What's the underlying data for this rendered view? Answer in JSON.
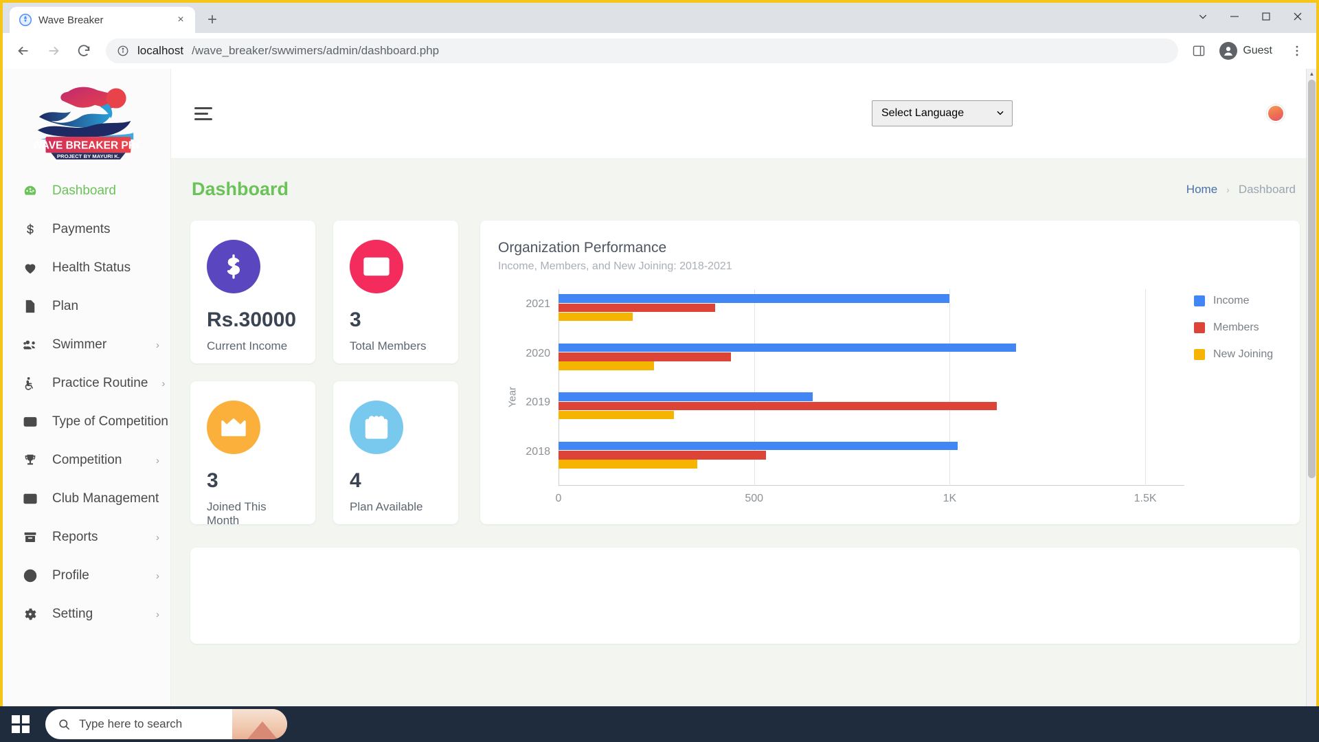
{
  "browser": {
    "tab_title": "Wave Breaker",
    "tab_favicon": "globe-icon",
    "new_tab_label": "+",
    "close_tab_label": "×",
    "url_host": "localhost",
    "url_path": "/wave_breaker/swwimers/admin/dashboard.php",
    "profile_label": "Guest"
  },
  "sidebar": {
    "brand": {
      "name": "WAVE BREAKER PRO",
      "tagline": "PROJECT BY MAYURI K."
    },
    "items": [
      {
        "label": "Dashboard",
        "icon": "dashboard-gauge-icon",
        "active": true,
        "caret": false
      },
      {
        "label": "Payments",
        "icon": "dollar-sign-icon",
        "active": false,
        "caret": false
      },
      {
        "label": "Health Status",
        "icon": "heart-icon",
        "active": false,
        "caret": false
      },
      {
        "label": "Plan",
        "icon": "file-lines-icon",
        "active": false,
        "caret": true
      },
      {
        "label": "Swimmer",
        "icon": "users-group-icon",
        "active": false,
        "caret": true
      },
      {
        "label": "Practice Routine",
        "icon": "wheelchair-icon",
        "active": false,
        "caret": true
      },
      {
        "label": "Type of Competition",
        "icon": "credit-card-icon",
        "active": false,
        "caret": true
      },
      {
        "label": "Competition",
        "icon": "trophy-icon",
        "active": false,
        "caret": true
      },
      {
        "label": "Club Management",
        "icon": "id-card-icon",
        "active": false,
        "caret": true
      },
      {
        "label": "Reports",
        "icon": "archive-box-icon",
        "active": false,
        "caret": true
      },
      {
        "label": "Profile",
        "icon": "user-circle-icon",
        "active": false,
        "caret": true
      },
      {
        "label": "Setting",
        "icon": "gear-icon",
        "active": false,
        "caret": true
      }
    ]
  },
  "topbar": {
    "menu_toggle": "hamburger-icon",
    "language_select": {
      "value": "Select Language",
      "caret": "⌄"
    },
    "avatar": "user-avatar"
  },
  "page": {
    "title": "Dashboard",
    "breadcrumb": {
      "home": "Home",
      "separator": "›",
      "current": "Dashboard"
    }
  },
  "stats": [
    {
      "value": "Rs.30000",
      "label": "Current Income",
      "icon": "dollar-sign-icon",
      "color": "#5a46bf"
    },
    {
      "value": "3",
      "label": "Total Members",
      "icon": "id-card-icon",
      "color": "#f42b5d"
    },
    {
      "value": "3",
      "label": "Joined This Month",
      "icon": "crown-icon",
      "color": "#fbb03b"
    },
    {
      "value": "4",
      "label": "Plan Available",
      "icon": "calendar-icon",
      "color": "#79c9ef"
    }
  ],
  "chart_data": {
    "type": "bar",
    "orientation": "horizontal",
    "title": "Organization Performance",
    "subtitle": "Income, Members, and New Joining: 2018-2021",
    "xlabel": "",
    "ylabel": "Year",
    "categories": [
      "2021",
      "2020",
      "2019",
      "2018"
    ],
    "series": [
      {
        "name": "Income",
        "color": "#4285f4",
        "values": [
          1000,
          1170,
          650,
          1020
        ]
      },
      {
        "name": "Members",
        "color": "#db4437",
        "values": [
          400,
          440,
          1120,
          530
        ]
      },
      {
        "name": "New Joining",
        "color": "#f4b400",
        "values": [
          190,
          245,
          295,
          355
        ]
      }
    ],
    "xlim": [
      0,
      1600
    ],
    "xticks": [
      0,
      500,
      1000,
      1500
    ],
    "xtick_labels": [
      "0",
      "500",
      "1K",
      "1.5K"
    ],
    "grid": true,
    "legend_position": "right"
  },
  "taskbar": {
    "start": "windows-logo-icon",
    "search_placeholder": "Type here to search",
    "search_icon": "search-icon"
  }
}
